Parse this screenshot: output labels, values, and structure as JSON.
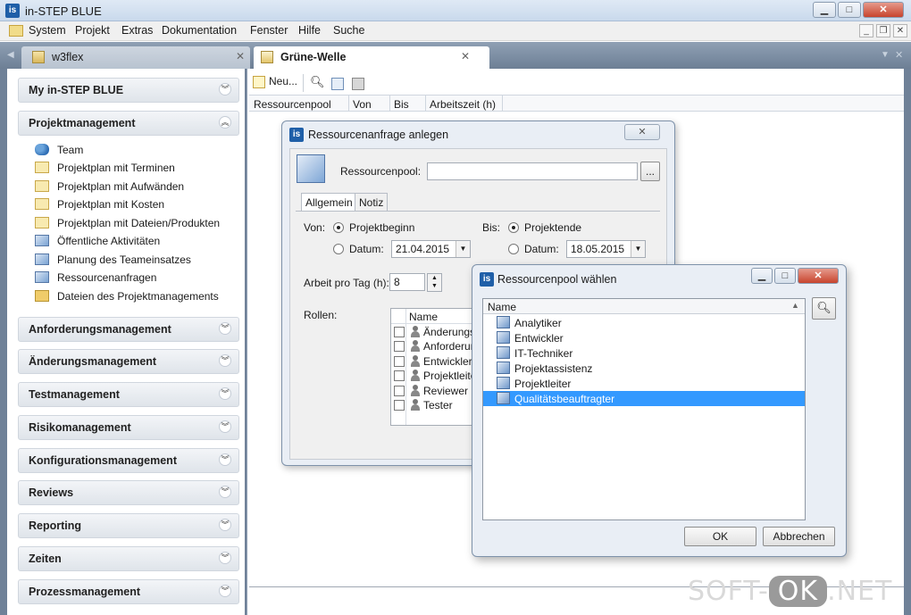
{
  "window": {
    "title": "in-STEP BLUE",
    "app_icon": "is"
  },
  "menu": [
    "System",
    "Projekt",
    "Extras",
    "Dokumentation",
    "Fenster",
    "Hilfe",
    "Suche"
  ],
  "tabs": [
    {
      "label": "w3flex",
      "active": false
    },
    {
      "label": "Grüne-Welle",
      "active": true
    }
  ],
  "sidebar": {
    "sections": [
      {
        "title": "My in-STEP BLUE",
        "expanded": false
      },
      {
        "title": "Projektmanagement",
        "expanded": true
      },
      {
        "title": "Anforderungsmanagement",
        "expanded": false
      },
      {
        "title": "Änderungsmanagement",
        "expanded": false
      },
      {
        "title": "Testmanagement",
        "expanded": false
      },
      {
        "title": "Risikomanagement",
        "expanded": false
      },
      {
        "title": "Konfigurationsmanagement",
        "expanded": false
      },
      {
        "title": "Reviews",
        "expanded": false
      },
      {
        "title": "Reporting",
        "expanded": false
      },
      {
        "title": "Zeiten",
        "expanded": false
      },
      {
        "title": "Prozessmanagement",
        "expanded": false
      }
    ],
    "pm_items": [
      {
        "label": "Team",
        "icon": "team-icon"
      },
      {
        "label": "Projektplan mit Terminen",
        "icon": "plan-icon"
      },
      {
        "label": "Projektplan mit Aufwänden",
        "icon": "plan-icon"
      },
      {
        "label": "Projektplan mit Kosten",
        "icon": "plan-icon"
      },
      {
        "label": "Projektplan mit Dateien/Produkten",
        "icon": "plan-icon"
      },
      {
        "label": "Öffentliche Aktivitäten",
        "icon": "activity-icon"
      },
      {
        "label": "Planung des Teameinsatzes",
        "icon": "resource-icon"
      },
      {
        "label": "Ressourcenanfragen",
        "icon": "resource-icon"
      },
      {
        "label": "Dateien des Projektmanagements",
        "icon": "folder-icon"
      }
    ]
  },
  "toolbar": {
    "new_label": "Neu..."
  },
  "table": {
    "columns": [
      "Ressourcenpool",
      "Von",
      "Bis",
      "Arbeitszeit (h)"
    ]
  },
  "dialog1": {
    "title": "Ressourcenanfrage anlegen",
    "pool_label": "Ressourcenpool:",
    "pool_value": "",
    "browse_label": "...",
    "tabs": [
      "Allgemein",
      "Notiz"
    ],
    "von_label": "Von:",
    "bis_label": "Bis:",
    "projektbeginn": "Projektbeginn",
    "projektende": "Projektende",
    "datum_label": "Datum:",
    "von_date": "21.04.2015",
    "bis_date": "18.05.2015",
    "arbeit_label": "Arbeit pro Tag (h):",
    "arbeit_value": "8",
    "rollen_label": "Rollen:",
    "roles_header": "Name",
    "roles": [
      "Änderungs",
      "Anforderun",
      "Entwickler",
      "Projektleite",
      "Reviewer",
      "Tester"
    ]
  },
  "dialog2": {
    "title": "Ressourcenpool wählen",
    "header": "Name",
    "items": [
      "Analytiker",
      "Entwickler",
      "IT-Techniker",
      "Projektassistenz",
      "Projektleiter",
      "Qualitätsbeauftragter"
    ],
    "selected_index": 5,
    "ok_label": "OK",
    "cancel_label": "Abbrechen"
  },
  "watermark": {
    "left": "SOFT-",
    "mid": "OK",
    "right": ".NET"
  },
  "colors": {
    "selection": "#3399ff",
    "tabbar": "#7a8ca2"
  }
}
